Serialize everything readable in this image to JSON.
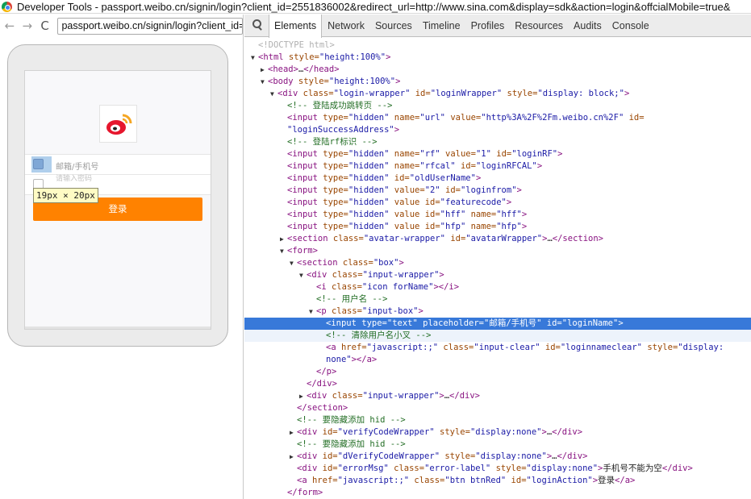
{
  "window": {
    "title": "Developer Tools - passport.weibo.cn/signin/login?client_id=2551836002&redirect_url=http://www.sina.com&display=sdk&action=login&offcialMobile=true&"
  },
  "browser": {
    "back": "←",
    "forward": "→",
    "reload": "C",
    "url": "passport.weibo.cn/signin/login?client_id=2"
  },
  "page_preview": {
    "username_placeholder": "邮箱/手机号",
    "password_placeholder": "请输入密码",
    "size_tooltip": "19px × 20px",
    "login_button": "登录"
  },
  "devtools": {
    "tabs": [
      "Elements",
      "Network",
      "Sources",
      "Timeline",
      "Profiles",
      "Resources",
      "Audits",
      "Console"
    ],
    "active_tab": "Elements",
    "tree": [
      {
        "indent": 0,
        "tri": "",
        "parts": [
          [
            "doctype",
            "<!DOCTYPE html>"
          ]
        ]
      },
      {
        "indent": 0,
        "tri": "▼",
        "parts": [
          [
            "tag",
            "<html"
          ],
          [
            "attr",
            " style="
          ],
          [
            "val",
            "\"height:100%\""
          ],
          [
            "tag",
            ">"
          ]
        ]
      },
      {
        "indent": 1,
        "tri": "▶",
        "parts": [
          [
            "tag",
            "<head>"
          ],
          [
            "txt",
            "…"
          ],
          [
            "tag",
            "</head>"
          ]
        ]
      },
      {
        "indent": 1,
        "tri": "▼",
        "parts": [
          [
            "tag",
            "<body"
          ],
          [
            "attr",
            " style="
          ],
          [
            "val",
            "\"height:100%\""
          ],
          [
            "tag",
            ">"
          ]
        ]
      },
      {
        "indent": 2,
        "tri": "▼",
        "parts": [
          [
            "tag",
            "<div"
          ],
          [
            "attr",
            " class="
          ],
          [
            "val",
            "\"login-wrapper\""
          ],
          [
            "attr",
            " id="
          ],
          [
            "val",
            "\"loginWrapper\""
          ],
          [
            "attr",
            " style="
          ],
          [
            "val",
            "\"display: block;\""
          ],
          [
            "tag",
            ">"
          ]
        ]
      },
      {
        "indent": 3,
        "tri": "",
        "parts": [
          [
            "cmt",
            "<!-- 登陆成功跳转页 -->"
          ]
        ]
      },
      {
        "indent": 3,
        "tri": "",
        "parts": [
          [
            "tag",
            "<input"
          ],
          [
            "attr",
            " type="
          ],
          [
            "val",
            "\"hidden\""
          ],
          [
            "attr",
            " name="
          ],
          [
            "val",
            "\"url\""
          ],
          [
            "attr",
            " value="
          ],
          [
            "val",
            "\"http%3A%2F%2Fm.weibo.cn%2F\""
          ],
          [
            "attr",
            " id="
          ]
        ]
      },
      {
        "indent": 3,
        "tri": "",
        "parts": [
          [
            "val",
            "\"loginSuccessAddress\""
          ],
          [
            "tag",
            ">"
          ]
        ]
      },
      {
        "indent": 3,
        "tri": "",
        "parts": [
          [
            "cmt",
            "<!-- 登陆rf标识 -->"
          ]
        ]
      },
      {
        "indent": 3,
        "tri": "",
        "parts": [
          [
            "tag",
            "<input"
          ],
          [
            "attr",
            " type="
          ],
          [
            "val",
            "\"hidden\""
          ],
          [
            "attr",
            " name="
          ],
          [
            "val",
            "\"rf\""
          ],
          [
            "attr",
            " value="
          ],
          [
            "val",
            "\"1\""
          ],
          [
            "attr",
            " id="
          ],
          [
            "val",
            "\"loginRF\""
          ],
          [
            "tag",
            ">"
          ]
        ]
      },
      {
        "indent": 3,
        "tri": "",
        "parts": [
          [
            "tag",
            "<input"
          ],
          [
            "attr",
            " type="
          ],
          [
            "val",
            "\"hidden\""
          ],
          [
            "attr",
            " name="
          ],
          [
            "val",
            "\"rfcal\""
          ],
          [
            "attr",
            " id="
          ],
          [
            "val",
            "\"loginRFCAL\""
          ],
          [
            "tag",
            ">"
          ]
        ]
      },
      {
        "indent": 3,
        "tri": "",
        "parts": [
          [
            "tag",
            "<input"
          ],
          [
            "attr",
            " type="
          ],
          [
            "val",
            "\"hidden\""
          ],
          [
            "attr",
            " id="
          ],
          [
            "val",
            "\"oldUserName\""
          ],
          [
            "tag",
            ">"
          ]
        ]
      },
      {
        "indent": 3,
        "tri": "",
        "parts": [
          [
            "tag",
            "<input"
          ],
          [
            "attr",
            " type="
          ],
          [
            "val",
            "\"hidden\""
          ],
          [
            "attr",
            " value="
          ],
          [
            "val",
            "\"2\""
          ],
          [
            "attr",
            " id="
          ],
          [
            "val",
            "\"loginfrom\""
          ],
          [
            "tag",
            ">"
          ]
        ]
      },
      {
        "indent": 3,
        "tri": "",
        "parts": [
          [
            "tag",
            "<input"
          ],
          [
            "attr",
            " type="
          ],
          [
            "val",
            "\"hidden\""
          ],
          [
            "attr",
            " value id="
          ],
          [
            "val",
            "\"featurecode\""
          ],
          [
            "tag",
            ">"
          ]
        ]
      },
      {
        "indent": 3,
        "tri": "",
        "parts": [
          [
            "tag",
            "<input"
          ],
          [
            "attr",
            " type="
          ],
          [
            "val",
            "\"hidden\""
          ],
          [
            "attr",
            " value id="
          ],
          [
            "val",
            "\"hff\""
          ],
          [
            "attr",
            " name="
          ],
          [
            "val",
            "\"hff\""
          ],
          [
            "tag",
            ">"
          ]
        ]
      },
      {
        "indent": 3,
        "tri": "",
        "parts": [
          [
            "tag",
            "<input"
          ],
          [
            "attr",
            " type="
          ],
          [
            "val",
            "\"hidden\""
          ],
          [
            "attr",
            " value id="
          ],
          [
            "val",
            "\"hfp\""
          ],
          [
            "attr",
            " name="
          ],
          [
            "val",
            "\"hfp\""
          ],
          [
            "tag",
            ">"
          ]
        ]
      },
      {
        "indent": 3,
        "tri": "▶",
        "parts": [
          [
            "tag",
            "<section"
          ],
          [
            "attr",
            " class="
          ],
          [
            "val",
            "\"avatar-wrapper\""
          ],
          [
            "attr",
            " id="
          ],
          [
            "val",
            "\"avatarWrapper\""
          ],
          [
            "tag",
            ">"
          ],
          [
            "txt",
            "…"
          ],
          [
            "tag",
            "</section>"
          ]
        ]
      },
      {
        "indent": 3,
        "tri": "▼",
        "parts": [
          [
            "tag",
            "<form>"
          ]
        ]
      },
      {
        "indent": 4,
        "tri": "▼",
        "parts": [
          [
            "tag",
            "<section"
          ],
          [
            "attr",
            " class="
          ],
          [
            "val",
            "\"box\""
          ],
          [
            "tag",
            ">"
          ]
        ]
      },
      {
        "indent": 5,
        "tri": "▼",
        "parts": [
          [
            "tag",
            "<div"
          ],
          [
            "attr",
            " class="
          ],
          [
            "val",
            "\"input-wrapper\""
          ],
          [
            "tag",
            ">"
          ]
        ]
      },
      {
        "indent": 6,
        "tri": "",
        "parts": [
          [
            "tag",
            "<i"
          ],
          [
            "attr",
            " class="
          ],
          [
            "val",
            "\"icon forName\""
          ],
          [
            "tag",
            "></i>"
          ]
        ]
      },
      {
        "indent": 6,
        "tri": "",
        "parts": [
          [
            "cmt",
            "<!-- 用户名 -->"
          ]
        ]
      },
      {
        "indent": 6,
        "tri": "▼",
        "parts": [
          [
            "tag",
            "<p"
          ],
          [
            "attr",
            " class="
          ],
          [
            "val",
            "\"input-box\""
          ],
          [
            "tag",
            ">"
          ]
        ]
      },
      {
        "indent": 7,
        "tri": "",
        "sel": true,
        "parts": [
          [
            "tag",
            "<input"
          ],
          [
            "attr",
            " type="
          ],
          [
            "val",
            "\"text\""
          ],
          [
            "attr",
            " placeholder="
          ],
          [
            "val",
            "\"邮箱/手机号\""
          ],
          [
            "attr",
            " id="
          ],
          [
            "val",
            "\"loginName\""
          ],
          [
            "tag",
            ">"
          ]
        ]
      },
      {
        "indent": 7,
        "tri": "",
        "hov": true,
        "parts": [
          [
            "cmt",
            "<!-- 清除用户名小叉 -->"
          ]
        ]
      },
      {
        "indent": 7,
        "tri": "",
        "parts": [
          [
            "tag",
            "<a"
          ],
          [
            "attr",
            " href="
          ],
          [
            "val",
            "\"javascript:;\""
          ],
          [
            "attr",
            " class="
          ],
          [
            "val",
            "\"input-clear\""
          ],
          [
            "attr",
            " id="
          ],
          [
            "val",
            "\"loginnameclear\""
          ],
          [
            "attr",
            " style="
          ],
          [
            "val",
            "\"display:"
          ]
        ]
      },
      {
        "indent": 7,
        "tri": "",
        "parts": [
          [
            "val",
            "none\""
          ],
          [
            "tag",
            "></a>"
          ]
        ]
      },
      {
        "indent": 6,
        "tri": "",
        "parts": [
          [
            "tag",
            "</p>"
          ]
        ]
      },
      {
        "indent": 5,
        "tri": "",
        "parts": [
          [
            "tag",
            "</div>"
          ]
        ]
      },
      {
        "indent": 5,
        "tri": "▶",
        "parts": [
          [
            "tag",
            "<div"
          ],
          [
            "attr",
            " class="
          ],
          [
            "val",
            "\"input-wrapper\""
          ],
          [
            "tag",
            ">"
          ],
          [
            "txt",
            "…"
          ],
          [
            "tag",
            "</div>"
          ]
        ]
      },
      {
        "indent": 4,
        "tri": "",
        "parts": [
          [
            "tag",
            "</section>"
          ]
        ]
      },
      {
        "indent": 4,
        "tri": "",
        "parts": [
          [
            "cmt",
            "<!-- 要隐藏添加 hid -->"
          ]
        ]
      },
      {
        "indent": 4,
        "tri": "▶",
        "parts": [
          [
            "tag",
            "<div"
          ],
          [
            "attr",
            " id="
          ],
          [
            "val",
            "\"verifyCodeWrapper\""
          ],
          [
            "attr",
            " style="
          ],
          [
            "val",
            "\"display:none\""
          ],
          [
            "tag",
            ">"
          ],
          [
            "txt",
            "…"
          ],
          [
            "tag",
            "</div>"
          ]
        ]
      },
      {
        "indent": 4,
        "tri": "",
        "parts": [
          [
            "cmt",
            "<!-- 要隐藏添加 hid -->"
          ]
        ]
      },
      {
        "indent": 4,
        "tri": "▶",
        "parts": [
          [
            "tag",
            "<div"
          ],
          [
            "attr",
            " id="
          ],
          [
            "val",
            "\"dVerifyCodeWrapper\""
          ],
          [
            "attr",
            " style="
          ],
          [
            "val",
            "\"display:none\""
          ],
          [
            "tag",
            ">"
          ],
          [
            "txt",
            "…"
          ],
          [
            "tag",
            "</div>"
          ]
        ]
      },
      {
        "indent": 4,
        "tri": "",
        "parts": [
          [
            "tag",
            "<div"
          ],
          [
            "attr",
            " id="
          ],
          [
            "val",
            "\"errorMsg\""
          ],
          [
            "attr",
            " class="
          ],
          [
            "val",
            "\"error-label\""
          ],
          [
            "attr",
            " style="
          ],
          [
            "val",
            "\"display:none\""
          ],
          [
            "tag",
            ">"
          ],
          [
            "txt",
            "手机号不能为空"
          ],
          [
            "tag",
            "</div>"
          ]
        ]
      },
      {
        "indent": 4,
        "tri": "",
        "parts": [
          [
            "tag",
            "<a"
          ],
          [
            "attr",
            " href="
          ],
          [
            "val",
            "\"javascript:;\""
          ],
          [
            "attr",
            " class="
          ],
          [
            "val",
            "\"btn btnRed\""
          ],
          [
            "attr",
            " id="
          ],
          [
            "val",
            "\"loginAction\""
          ],
          [
            "tag",
            ">"
          ],
          [
            "txt",
            "登录"
          ],
          [
            "tag",
            "</a>"
          ]
        ]
      },
      {
        "indent": 3,
        "tri": "",
        "parts": [
          [
            "tag",
            "</form>"
          ]
        ]
      }
    ]
  }
}
